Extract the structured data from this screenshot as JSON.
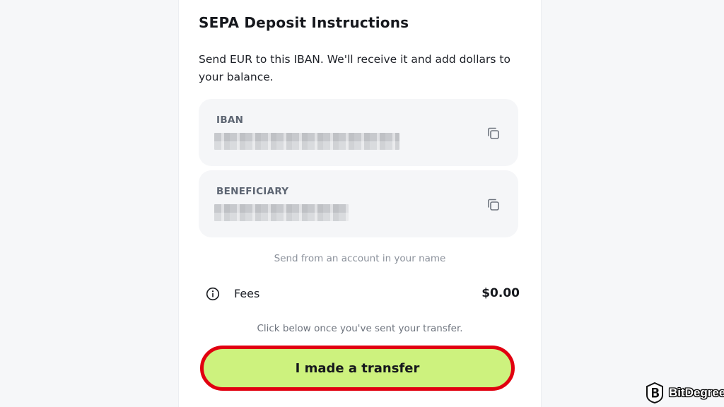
{
  "header": {
    "title": "SEPA Deposit Instructions"
  },
  "description": "Send EUR to this IBAN. We'll receive it and add dollars to your balance.",
  "fields": {
    "iban": {
      "label": "IBAN",
      "value_masked": true,
      "copy_icon": "copy-icon"
    },
    "beneficiary": {
      "label": "BENEFICIARY",
      "value_masked": true,
      "copy_icon": "copy-icon"
    }
  },
  "notice": "Send from an account in your name",
  "fees": {
    "icon": "info-icon",
    "label": "Fees",
    "value": "$0.00"
  },
  "confirm_hint": "Click below once you've sent your transfer.",
  "cta": {
    "label": "I made a transfer",
    "bg_color": "#cdf27e",
    "highlight_color": "#e10010"
  },
  "watermark": {
    "text": "BitDegree"
  }
}
